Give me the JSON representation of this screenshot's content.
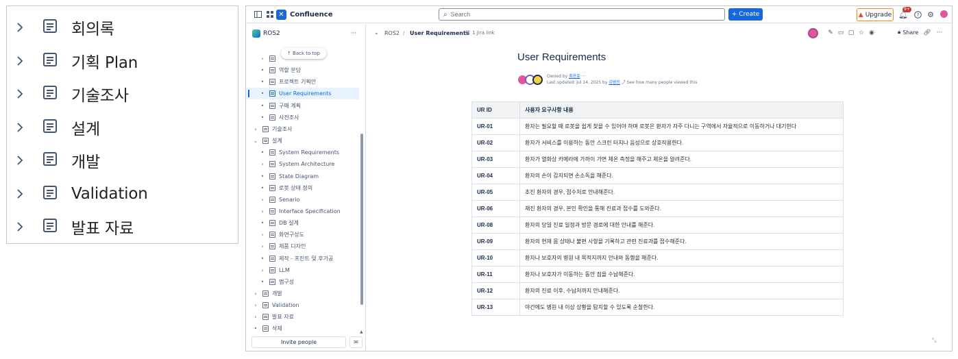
{
  "zoom_panel": {
    "items": [
      {
        "label": "회의록"
      },
      {
        "label": "기획 Plan"
      },
      {
        "label": "기술조사"
      },
      {
        "label": "설계"
      },
      {
        "label": "개발"
      },
      {
        "label": "Validation"
      },
      {
        "label": "발표 자료"
      }
    ]
  },
  "topbar": {
    "product": "Confluence",
    "search_placeholder": "Search",
    "create_label": "+ Create",
    "upgrade_label": "Upgrade",
    "notif_count": "9+"
  },
  "sidebar": {
    "space_name": "ROS2",
    "space_more": "···",
    "back_to_top": "↑ Back to top",
    "items": [
      {
        "label": "",
        "marker": "›"
      },
      {
        "label": "역할 분담",
        "marker": "•"
      },
      {
        "label": "프로젝트 기획안",
        "marker": "•"
      },
      {
        "label": "User Requirements",
        "marker": "•",
        "selected": true
      },
      {
        "label": "구매 계획",
        "marker": "•"
      },
      {
        "label": "사전조사",
        "marker": "•"
      },
      {
        "label": "기술조사",
        "marker": "›"
      },
      {
        "label": "설계",
        "marker": "⌄"
      },
      {
        "label": "System Requirements",
        "marker": "•"
      },
      {
        "label": "System Architecture",
        "marker": "›"
      },
      {
        "label": "State Diagram",
        "marker": "•"
      },
      {
        "label": "로봇 상태 정의",
        "marker": "•"
      },
      {
        "label": "Senario",
        "marker": "›"
      },
      {
        "label": "Interface Specification",
        "marker": "›"
      },
      {
        "label": "DB 설계",
        "marker": "•"
      },
      {
        "label": "화면구성도",
        "marker": "›"
      },
      {
        "label": "제품 디자인",
        "marker": "›"
      },
      {
        "label": "제작 - 프린트 및 후가공",
        "marker": "•"
      },
      {
        "label": "LLM",
        "marker": "›"
      },
      {
        "label": "맵구성",
        "marker": "•"
      },
      {
        "label": "개발",
        "marker": "›"
      },
      {
        "label": "Validation",
        "marker": "›"
      },
      {
        "label": "발표 자료",
        "marker": "›"
      },
      {
        "label": "삭제",
        "marker": "•"
      }
    ],
    "invite_label": "Invite people"
  },
  "content": {
    "breadcrumb": {
      "space": "ROS2",
      "separator": "/",
      "page": "User Requirements",
      "jira": "1 Jira link"
    },
    "share_label": "Share",
    "title": "User Requirements",
    "owned_by_prefix": "Owned by",
    "owner": "최윤호",
    "owned_more": "···",
    "last_updated_prefix": "Last updated: Jul 14, 2025 by",
    "updater": "김범진",
    "views_label": "See how many people viewed this"
  },
  "table": {
    "headers": [
      "UR ID",
      "사용자 요구사항 내용"
    ],
    "rows": [
      {
        "id": "UR-01",
        "desc": "환자는 필요할 때 로봇을 쉽게 찾을 수 있어야 하며 로봇은 환자가 자주 다니는 구역에서 자율적으로 이동하거나 대기한다"
      },
      {
        "id": "UR-02",
        "desc": "환자가 서비스를 이용하는 동안 스크린 터치나 음성으로 상호작용한다."
      },
      {
        "id": "UR-03",
        "desc": "환자가 열화상 카메라에 가까이 가면 체온 측정을 해주고 체온을 알려준다."
      },
      {
        "id": "UR-04",
        "desc": "환자의 손이 감지되면 손소독을 해준다."
      },
      {
        "id": "UR-05",
        "desc": "초진 환자의 경우, 접수처로 안내해준다."
      },
      {
        "id": "UR-06",
        "desc": "재진 환자의 경우, 본인 확인을 통해 진료과 접수를 도와준다."
      },
      {
        "id": "UR-08",
        "desc": "환자의 당일 진료 일정과 방문 경로에 대한 안내를 해준다."
      },
      {
        "id": "UR-09",
        "desc": "환자의 현재 몸 상태나 불편 사항을 기록하고 관련 진료과를 접수해준다."
      },
      {
        "id": "UR-10",
        "desc": "환자나 보호자의 병원 내 목적지까지 안내와 동행을 해준다."
      },
      {
        "id": "UR-11",
        "desc": "환자나 보호자가 이동하는 동안 짐을 수납해준다."
      },
      {
        "id": "UR-12",
        "desc": "환자의 진료 이후, 수납처까지 안내해준다."
      },
      {
        "id": "UR-13",
        "desc": "야간에도 병원 내 이상 상황을 탐지할 수 있도록 순찰한다."
      }
    ]
  }
}
